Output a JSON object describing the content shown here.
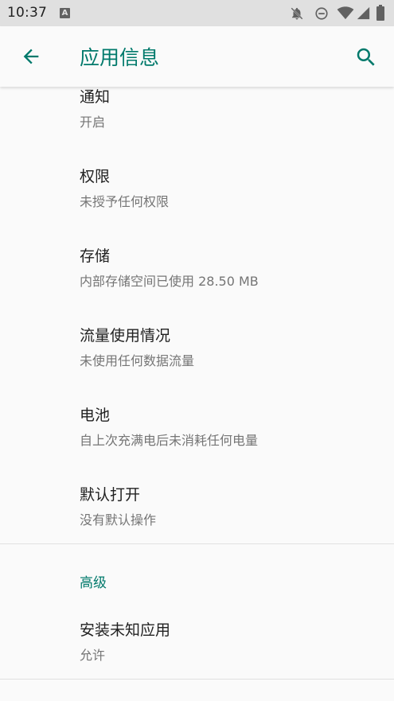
{
  "status_bar": {
    "time": "10:37",
    "app_icon_letter": "A",
    "icons": [
      "notifications-off-icon",
      "do-not-disturb-icon",
      "wifi-icon",
      "signal-icon",
      "battery-icon"
    ]
  },
  "toolbar": {
    "title": "应用信息",
    "accent_color": "#00796b"
  },
  "items": [
    {
      "title": "通知",
      "subtitle": "开启"
    },
    {
      "title": "权限",
      "subtitle": "未授予任何权限"
    },
    {
      "title": "存储",
      "subtitle": "内部存储空间已使用 28.50 MB"
    },
    {
      "title": "流量使用情况",
      "subtitle": "未使用任何数据流量"
    },
    {
      "title": "电池",
      "subtitle": "自上次充满电后未消耗任何电量"
    },
    {
      "title": "默认打开",
      "subtitle": "没有默认操作"
    }
  ],
  "advanced": {
    "header": "高级",
    "items": [
      {
        "title": "安装未知应用",
        "subtitle": "允许"
      }
    ]
  }
}
